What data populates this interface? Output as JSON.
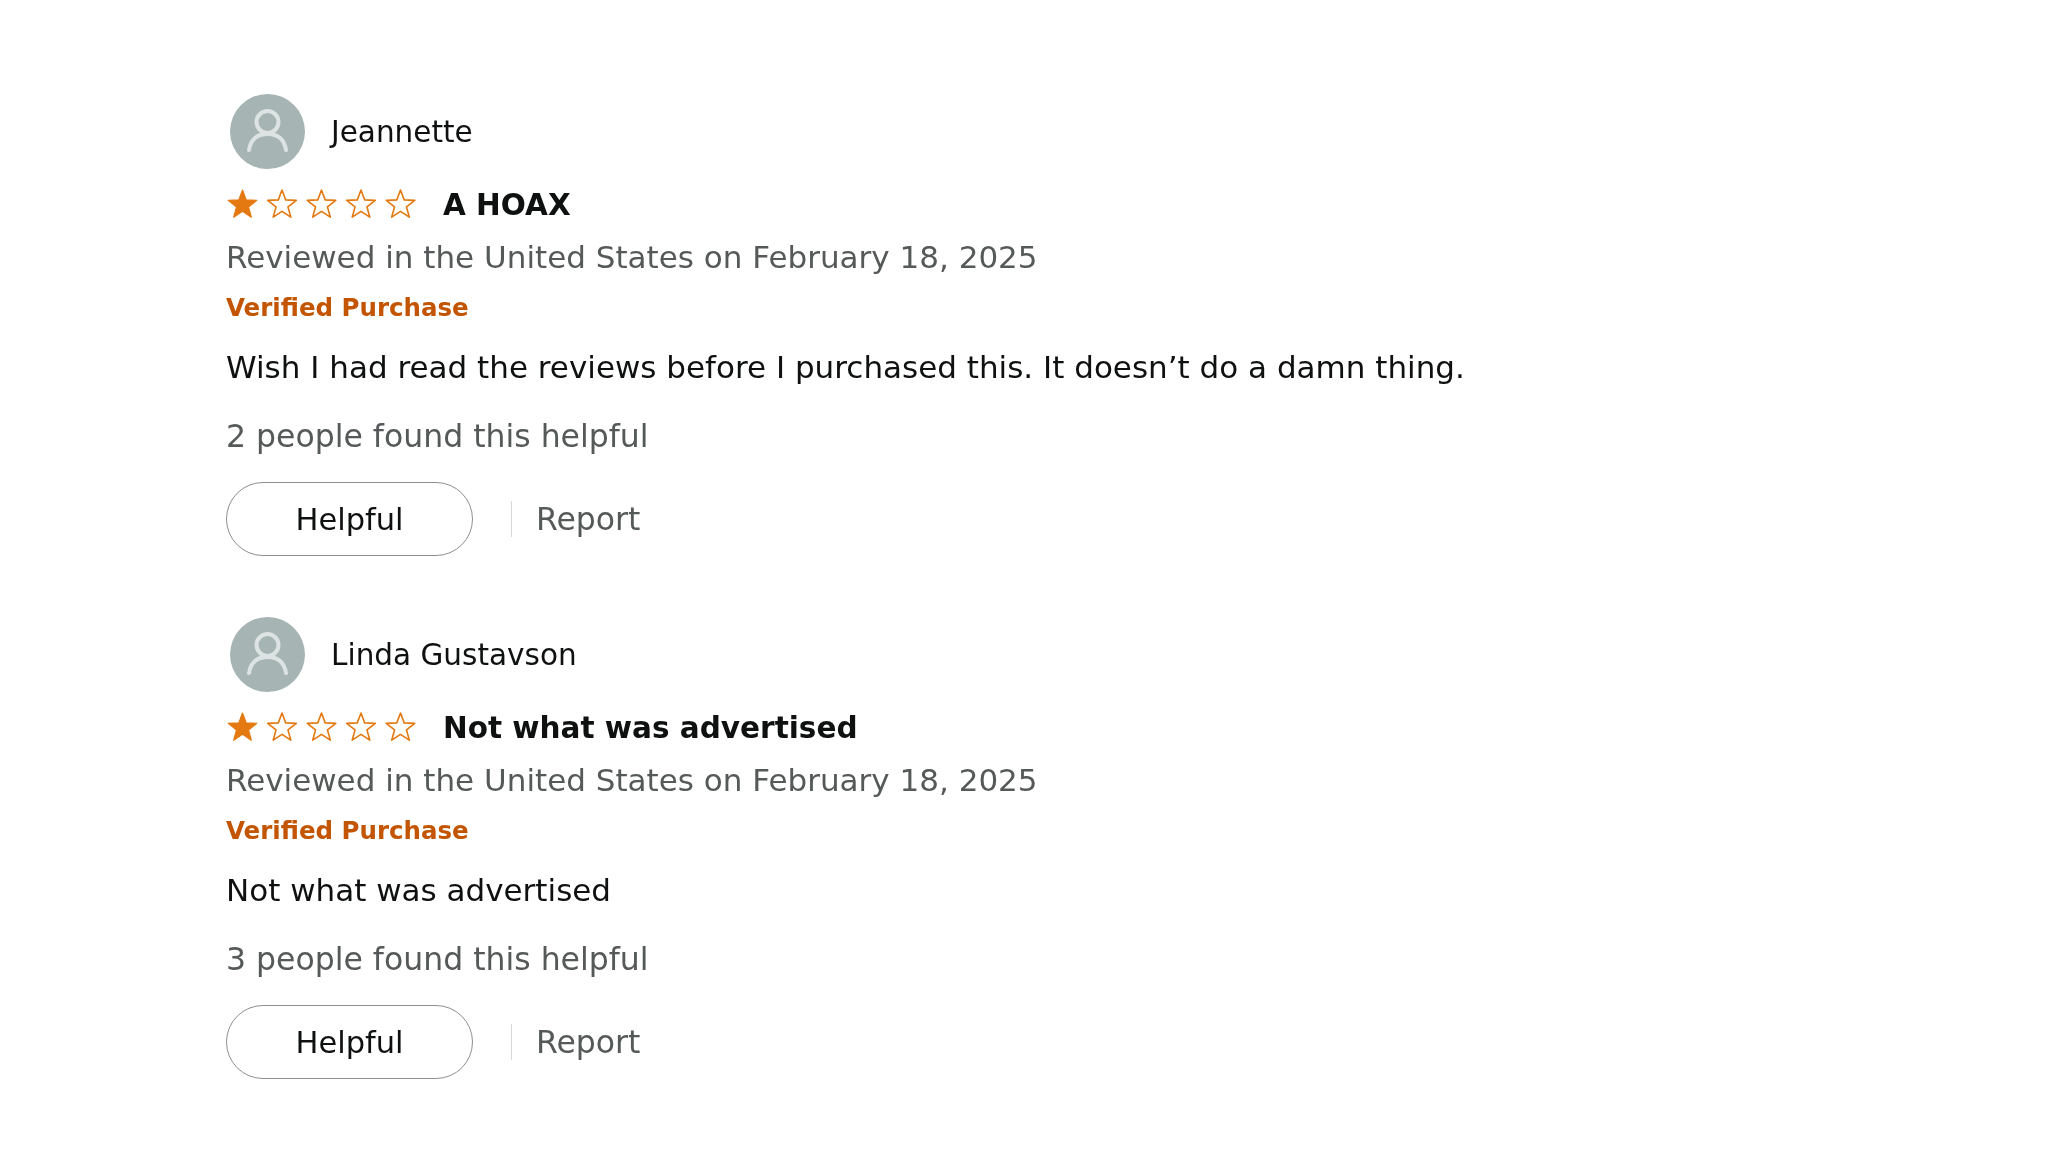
{
  "reviews": [
    {
      "reviewer": "Jeannette",
      "stars": 1,
      "title": "A HOAX",
      "date_line": "Reviewed in the United States on February 18, 2025",
      "badge": "Verified Purchase",
      "body": "Wish I had read the reviews before I purchased this. It doesn’t do a damn thing.",
      "helpful_count": "2 people found this helpful",
      "helpful_button": "Helpful",
      "report_link": "Report"
    },
    {
      "reviewer": "Linda Gustavson",
      "stars": 1,
      "title": "Not what was advertised",
      "date_line": "Reviewed in the United States on February 18, 2025",
      "badge": "Verified Purchase",
      "body": "Not what was advertised",
      "helpful_count": "3 people found this helpful",
      "helpful_button": "Helpful",
      "report_link": "Report"
    }
  ]
}
